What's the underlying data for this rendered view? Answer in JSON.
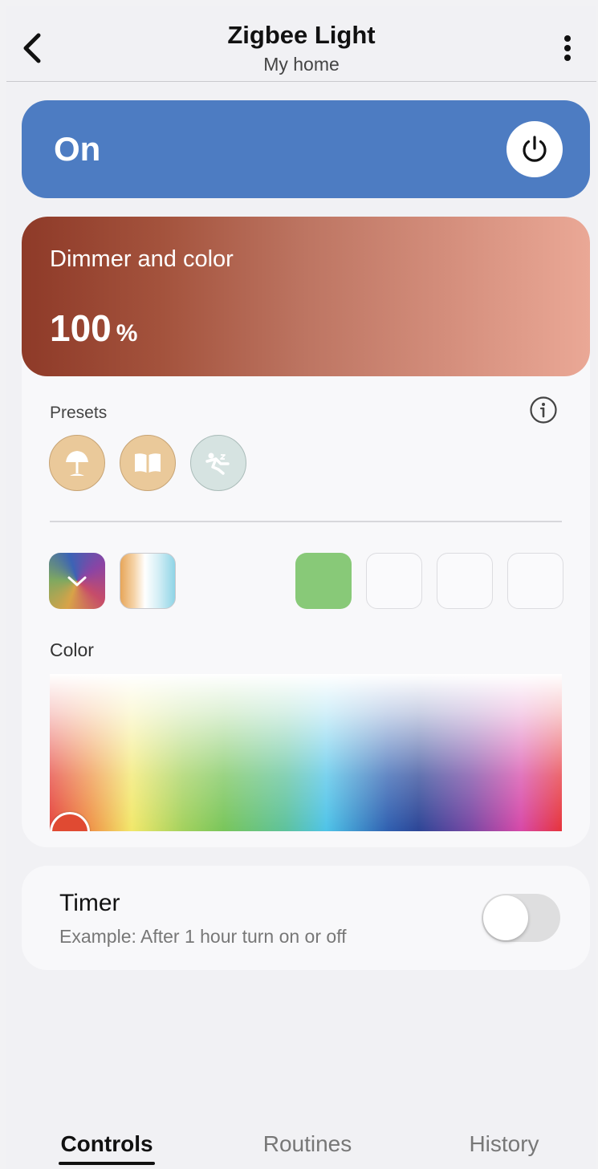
{
  "header": {
    "title": "Zigbee Light",
    "subtitle": "My home",
    "back_icon": "chevron-left-icon",
    "more_icon": "vertical-ellipsis-icon"
  },
  "power": {
    "status": "On",
    "icon": "power-icon",
    "is_on": true,
    "color": "#4d7cc2"
  },
  "dimmer": {
    "label": "Dimmer and color",
    "value": "100",
    "unit": "%",
    "brightness_percent": 100
  },
  "presets": {
    "label": "Presets",
    "info_icon": "info-icon",
    "items": [
      {
        "icon": "table-lamp-icon"
      },
      {
        "icon": "open-book-icon"
      },
      {
        "icon": "sleeping-person-icon"
      }
    ]
  },
  "color_modes": [
    {
      "icon": "color-wheel-icon"
    },
    {
      "icon": "white-temperature-icon"
    }
  ],
  "swatches": [
    "#88c978",
    "",
    "",
    ""
  ],
  "color": {
    "label": "Color",
    "selected": "#e04a32"
  },
  "timer": {
    "title": "Timer",
    "description": "Example: After 1 hour turn on or off",
    "enabled": false
  },
  "tabs": [
    {
      "label": "Controls",
      "active": true
    },
    {
      "label": "Routines",
      "active": false
    },
    {
      "label": "History",
      "active": false
    }
  ]
}
